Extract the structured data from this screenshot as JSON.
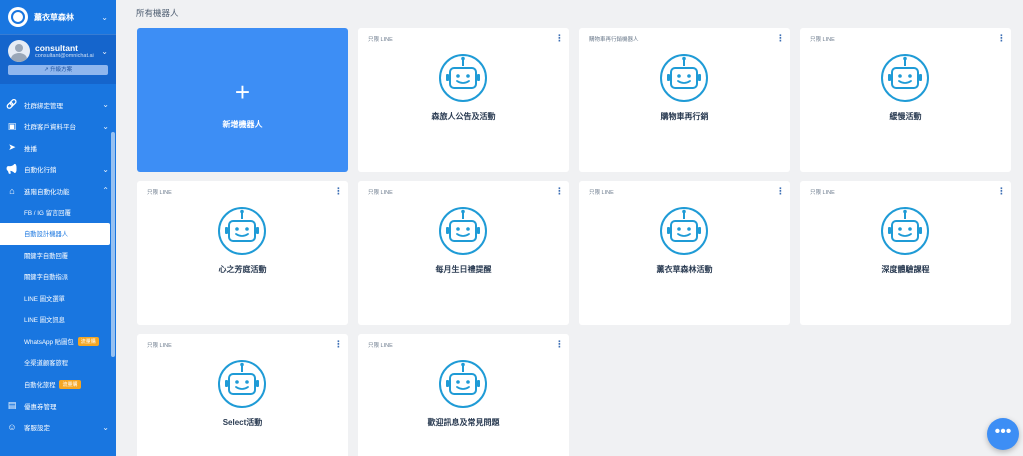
{
  "sidebar": {
    "workspace": "薰衣草森林",
    "account": {
      "name": "consultant",
      "email": "consultant@omnichat.ai",
      "upgrade": "升級方案"
    },
    "nav_top": [
      {
        "label": "社群綁定管理",
        "icon": "link-icon",
        "expandable": true
      },
      {
        "label": "社群客戶資料平台",
        "icon": "profile-card-icon",
        "expandable": true
      },
      {
        "label": "推播",
        "icon": "send-icon",
        "expandable": false
      },
      {
        "label": "自動化行銷",
        "icon": "megaphone-icon",
        "expandable": true
      },
      {
        "label": "進階自動化功能",
        "icon": "robot-icon",
        "expandable": true,
        "expanded": true
      }
    ],
    "sub_items": [
      {
        "label": "FB / IG 留言回覆",
        "badge": ""
      },
      {
        "label": "自動設計機器人",
        "badge": "",
        "active": true
      },
      {
        "label": "關鍵字自動回覆",
        "badge": ""
      },
      {
        "label": "關鍵字自動指派",
        "badge": ""
      },
      {
        "label": "LINE 圖文選單",
        "badge": ""
      },
      {
        "label": "LINE 圖文訊息",
        "badge": ""
      },
      {
        "label": "WhatsApp 貼圖包",
        "badge": "流量購"
      },
      {
        "label": "全渠道顧客旅程",
        "badge": ""
      },
      {
        "label": "自動化旅程",
        "badge": "流量購"
      }
    ],
    "nav_bottom": [
      {
        "label": "優惠券管理",
        "icon": "coupon-icon",
        "expandable": false
      },
      {
        "label": "客服設定",
        "icon": "agent-icon",
        "expandable": true
      }
    ]
  },
  "main": {
    "title": "所有機器人",
    "add_label": "新增機器人",
    "bots": [
      {
        "tag": "只限 LINE",
        "name": "森旅人公告及活動"
      },
      {
        "tag": "購物車再行銷機器人",
        "name": "購物車再行銷"
      },
      {
        "tag": "只限 LINE",
        "name": "緩慢活動"
      },
      {
        "tag": "只限 LINE",
        "name": "心之芳庭活動"
      },
      {
        "tag": "只限 LINE",
        "name": "每月生日禮提醒"
      },
      {
        "tag": "只限 LINE",
        "name": "薰衣草森林活動"
      },
      {
        "tag": "只限 LINE",
        "name": "深度體驗課程"
      },
      {
        "tag": "只限 LINE",
        "name": "Select活動"
      },
      {
        "tag": "只限 LINE",
        "name": "歡迎訊息及常見問題"
      }
    ]
  },
  "colors": {
    "sidebar": "#1976e0",
    "accent": "#3d8ef5",
    "robot": "#1f9bd6",
    "badge": "#f5a623"
  }
}
